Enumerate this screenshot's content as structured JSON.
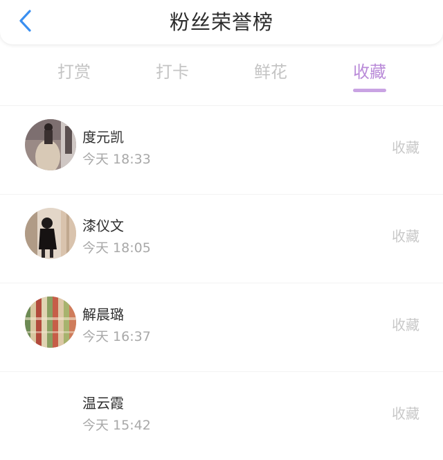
{
  "header": {
    "title": "粉丝荣誉榜",
    "back_icon": "chevron-left-icon",
    "back_color": "#3a8ff0"
  },
  "tabs": [
    {
      "label": "打赏",
      "active": false
    },
    {
      "label": "打卡",
      "active": false
    },
    {
      "label": "鲜花",
      "active": false
    },
    {
      "label": "收藏",
      "active": true
    }
  ],
  "colors": {
    "accent": "#b98ad8",
    "tab_inactive": "#c4c4c4",
    "muted_text": "#a8a8a8"
  },
  "fans": [
    {
      "name": "度元凯",
      "time": "今天 18:33",
      "action": "收藏",
      "avatar": "photo"
    },
    {
      "name": "漆仪文",
      "time": "今天 18:05",
      "action": "收藏",
      "avatar": "photo"
    },
    {
      "name": "解晨璐",
      "time": "今天 16:37",
      "action": "收藏",
      "avatar": "photo"
    },
    {
      "name": "温云霞",
      "time": "今天 15:42",
      "action": "收藏",
      "avatar": "none"
    }
  ]
}
